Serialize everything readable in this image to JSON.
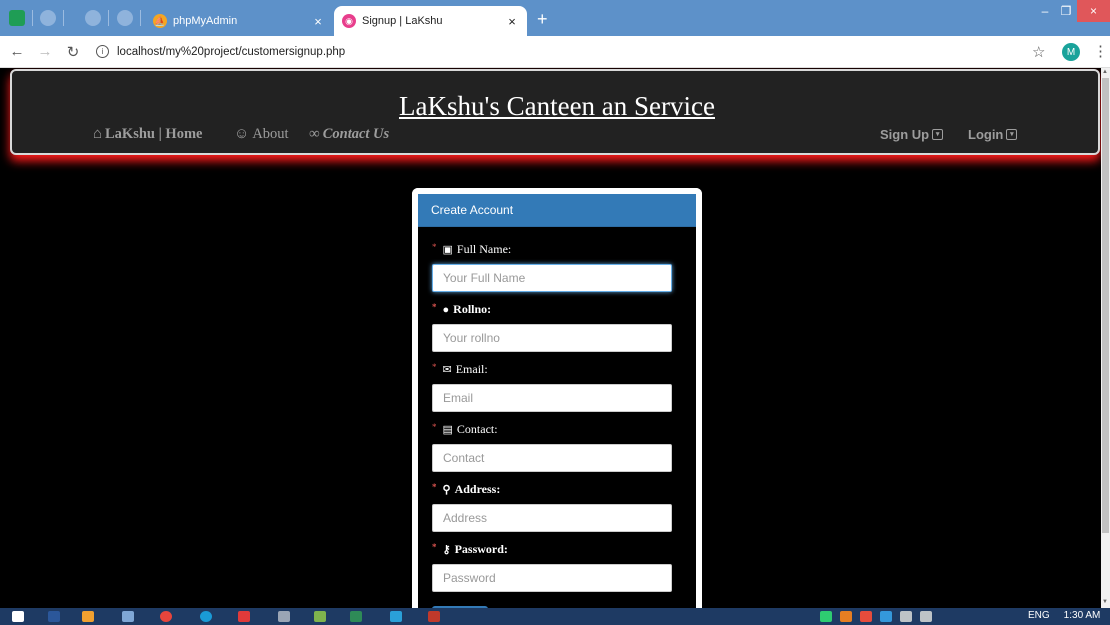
{
  "browser": {
    "tabs": [
      {
        "title": "phpMyAdmin",
        "close": "×"
      },
      {
        "title": "Signup | LaKshu",
        "close": "×"
      }
    ],
    "new_tab": "+",
    "window": {
      "min": "–",
      "max": "❐",
      "close": "×"
    },
    "url": "localhost/my%20project/customersignup.php",
    "profile_initial": "M"
  },
  "header": {
    "title": "LaKshu's Canteen an Service",
    "nav_left": [
      {
        "label": "LaKshu | Home",
        "icon": "home-icon"
      },
      {
        "label": "About",
        "icon": "smile-icon"
      },
      {
        "label": "Contact Us",
        "icon": "link-icon"
      }
    ],
    "nav_right": [
      {
        "label": "Sign Up",
        "icon": "caret-square-icon"
      },
      {
        "label": "Login",
        "icon": "caret-square-icon"
      }
    ]
  },
  "form": {
    "heading": "Create Account",
    "fields": [
      {
        "label": "Full Name:",
        "placeholder": "Your Full Name",
        "icon": "id-card-icon"
      },
      {
        "label": "Rollno:",
        "placeholder": "Your rollno",
        "icon": "user-icon"
      },
      {
        "label": "Email:",
        "placeholder": "Email",
        "icon": "envelope-icon"
      },
      {
        "label": "Contact:",
        "placeholder": "Contact",
        "icon": "phone-book-icon"
      },
      {
        "label": "Address:",
        "placeholder": "Address",
        "icon": "map-marker-icon"
      },
      {
        "label": "Password:",
        "placeholder": "Password",
        "icon": "key-icon"
      }
    ],
    "required_mark": "*"
  },
  "taskbar": {
    "language": "ENG",
    "time": "1:30 AM"
  },
  "colors": {
    "tab_strip": "#5d91c9",
    "panel_heading": "#337ab7",
    "header_glow": "#ff1a1a",
    "required": "#d9534f"
  }
}
